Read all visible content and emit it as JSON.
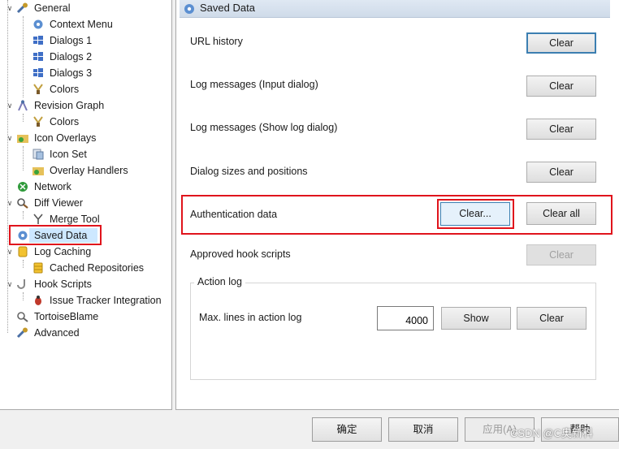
{
  "tree": {
    "items": [
      {
        "label": "General",
        "icon": "wrench-icon"
      },
      {
        "label": "Context Menu",
        "icon": "gear-icon"
      },
      {
        "label": "Dialogs 1",
        "icon": "windows-flag-icon"
      },
      {
        "label": "Dialogs 2",
        "icon": "windows-flag-icon"
      },
      {
        "label": "Dialogs 3",
        "icon": "windows-flag-icon"
      },
      {
        "label": "Colors",
        "icon": "paintbrush-icon"
      },
      {
        "label": "Revision Graph",
        "icon": "graph-icon"
      },
      {
        "label": "Colors",
        "icon": "paintbrush-icon"
      },
      {
        "label": "Icon Overlays",
        "icon": "folder-overlay-icon"
      },
      {
        "label": "Icon Set",
        "icon": "icon-set-icon"
      },
      {
        "label": "Overlay Handlers",
        "icon": "folder-overlay-icon"
      },
      {
        "label": "Network",
        "icon": "network-icon"
      },
      {
        "label": "Diff Viewer",
        "icon": "magnifier-icon"
      },
      {
        "label": "Merge Tool",
        "icon": "merge-icon"
      },
      {
        "label": "Saved Data",
        "icon": "gear-icon"
      },
      {
        "label": "Log Caching",
        "icon": "database-icon"
      },
      {
        "label": "Cached Repositories",
        "icon": "database-icon"
      },
      {
        "label": "Hook Scripts",
        "icon": "hook-icon"
      },
      {
        "label": "Issue Tracker Integration",
        "icon": "bug-icon"
      },
      {
        "label": "TortoiseBlame",
        "icon": "blame-icon"
      },
      {
        "label": "Advanced",
        "icon": "wrench-icon"
      }
    ]
  },
  "panel": {
    "title": "Saved Data",
    "rows": {
      "url_history": {
        "label": "URL history",
        "button": "Clear"
      },
      "log_input": {
        "label": "Log messages (Input dialog)",
        "button": "Clear"
      },
      "log_show": {
        "label": "Log messages (Show log dialog)",
        "button": "Clear"
      },
      "dialog_sizes": {
        "label": "Dialog sizes and positions",
        "button": "Clear"
      },
      "auth": {
        "label": "Authentication data",
        "button": "Clear...",
        "button_all": "Clear all"
      },
      "hooks": {
        "label": "Approved hook scripts",
        "button": "Clear"
      }
    },
    "action_log": {
      "legend": "Action log",
      "max_label": "Max. lines in action log",
      "max_value": "4000",
      "show_button": "Show",
      "clear_button": "Clear"
    }
  },
  "footer": {
    "ok": "确定",
    "cancel": "取消",
    "apply": "应用(A)",
    "help": "帮助",
    "watermark": "CSDN @C奥新科"
  },
  "colors": {
    "highlight_red": "#e0141c",
    "selection": "#cde8ff",
    "focus_border": "#3c7fb1"
  }
}
